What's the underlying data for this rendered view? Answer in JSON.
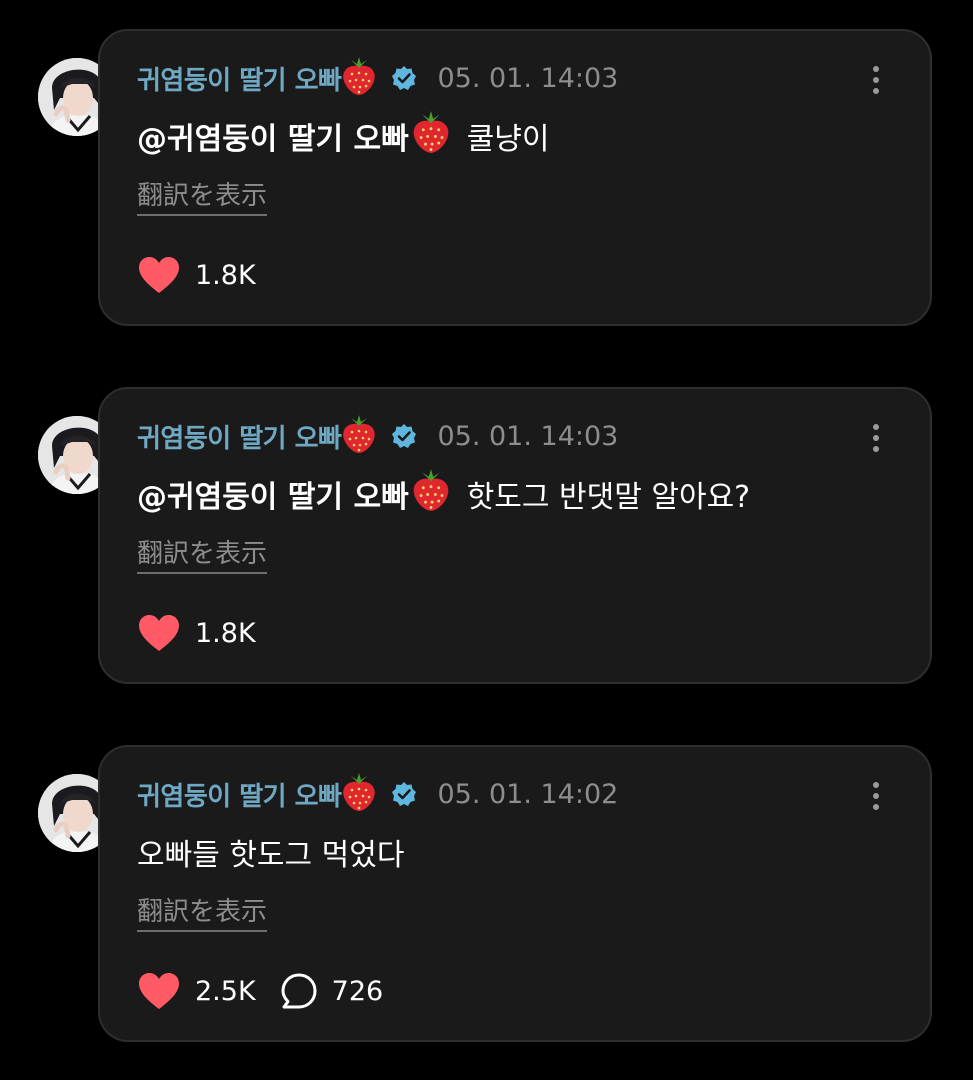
{
  "posts": [
    {
      "author": "귀염둥이 딸기 오빠",
      "timestamp": "05. 01. 14:03",
      "mention": "@귀염둥이 딸기 오빠",
      "message": "쿨냥이",
      "translate_label": "翻訳を表示",
      "likes": "1.8K"
    },
    {
      "author": "귀염둥이 딸기 오빠",
      "timestamp": "05. 01. 14:03",
      "mention": "@귀염둥이 딸기 오빠",
      "message": "핫도그 반댓말 알아요?",
      "translate_label": "翻訳を表示",
      "likes": "1.8K"
    },
    {
      "author": "귀염둥이 딸기 오빠",
      "timestamp": "05. 01. 14:02",
      "message": "오빠들 핫도그 먹었다",
      "translate_label": "翻訳を表示",
      "likes": "2.5K",
      "replies": "726"
    }
  ],
  "icons": {
    "strawberry": "strawberry-icon",
    "verified": "verified-badge-icon",
    "more": "more-vertical-icon",
    "like": "heart-icon",
    "reply": "comment-bubble-icon"
  },
  "colors": {
    "background": "#000000",
    "card": "#1a1a1b",
    "card_border": "#2e2e30",
    "author": "#6fa8c3",
    "verified": "#5fb7e0",
    "timestamp": "#8d8d8f",
    "heart": "#ff5a66"
  }
}
